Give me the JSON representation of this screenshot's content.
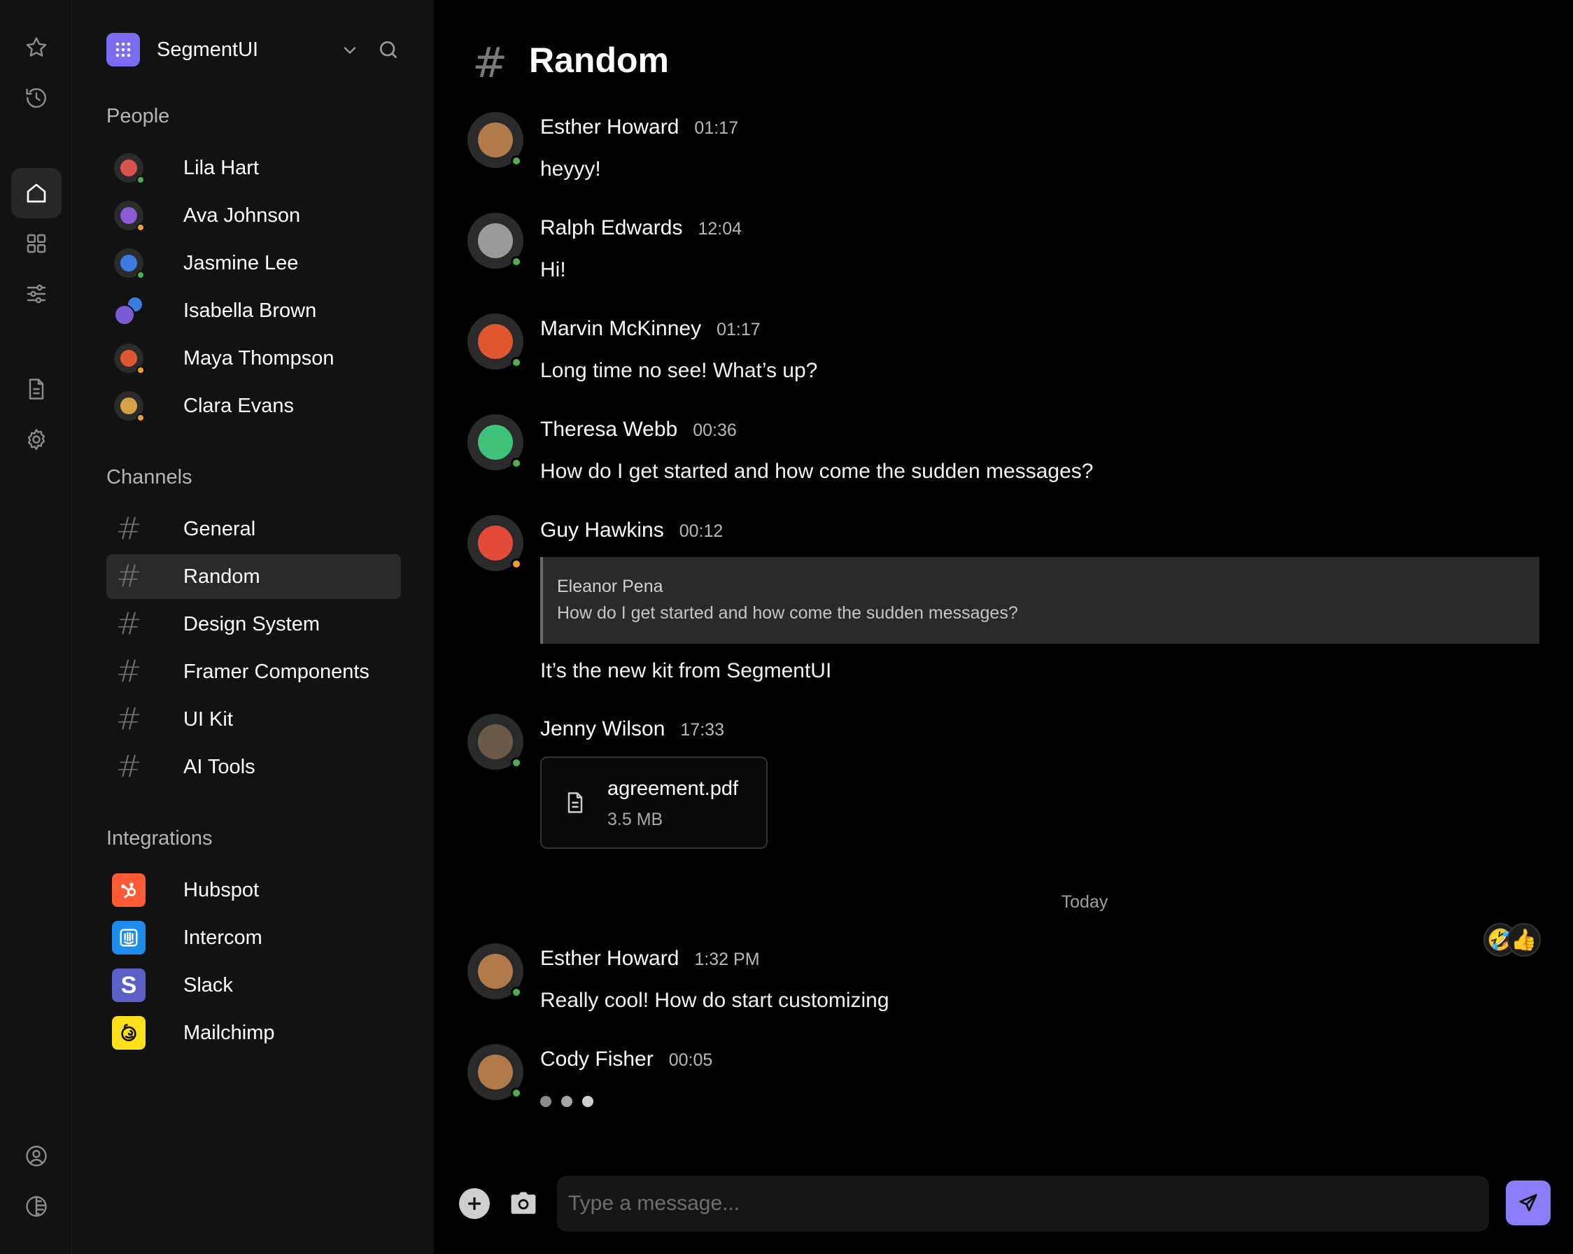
{
  "rail": {
    "items": [
      {
        "icon": "star-icon"
      },
      {
        "icon": "history-icon"
      },
      {
        "icon": "home-icon",
        "active": true
      },
      {
        "icon": "grid-icon"
      },
      {
        "icon": "sliders-icon"
      },
      {
        "icon": "document-icon"
      },
      {
        "icon": "settings-icon"
      },
      {
        "icon": "user-circle-icon"
      },
      {
        "icon": "theme-icon"
      }
    ]
  },
  "workspace": {
    "name": "SegmentUI"
  },
  "people": {
    "title": "People",
    "items": [
      {
        "name": "Lila Hart",
        "status": "online",
        "status_color": "#4caf50",
        "avatar_color": "#d9534f"
      },
      {
        "name": "Ava Johnson",
        "status": "away",
        "status_color": "#f0a030",
        "avatar_color": "#8e5bd6"
      },
      {
        "name": "Jasmine Lee",
        "status": "online",
        "status_color": "#4caf50",
        "avatar_color": "#3d7be0"
      },
      {
        "name": "Isabella Brown",
        "status": "group",
        "status_color": "#4caf50",
        "avatar_color": "#7a5bd6"
      },
      {
        "name": "Maya Thompson",
        "status": "away",
        "status_color": "#f0a030",
        "avatar_color": "#e0562f"
      },
      {
        "name": "Clara Evans",
        "status": "away",
        "status_color": "#f0a030",
        "avatar_color": "#d7a24a"
      }
    ]
  },
  "channels": {
    "title": "Channels",
    "items": [
      {
        "name": "General"
      },
      {
        "name": "Random",
        "active": true
      },
      {
        "name": "Design System"
      },
      {
        "name": "Framer Components"
      },
      {
        "name": "UI Kit"
      },
      {
        "name": "AI Tools"
      }
    ]
  },
  "integrations": {
    "title": "Integrations",
    "items": [
      {
        "name": "Hubspot",
        "icon": "hubspot-icon",
        "color": "#ff5c35"
      },
      {
        "name": "Intercom",
        "icon": "intercom-icon",
        "color": "#1f8ded"
      },
      {
        "name": "Slack",
        "icon": "slack-icon",
        "color": "#5b5fc7"
      },
      {
        "name": "Mailchimp",
        "icon": "mailchimp-icon",
        "color": "#ffe01b"
      }
    ]
  },
  "channel_header": {
    "hash": "#",
    "title": "Random"
  },
  "messages": [
    {
      "author": "Esther Howard",
      "time": "01:17",
      "text": "heyyy!",
      "status_color": "#4caf50",
      "avatar_color": "#b07a4a"
    },
    {
      "author": "Ralph Edwards",
      "time": "12:04",
      "text": "Hi!",
      "status_color": "#4caf50",
      "avatar_color": "#9a9a9a"
    },
    {
      "author": "Marvin McKinney",
      "time": "01:17",
      "text": "Long time no see! What’s up?",
      "status_color": "#4caf50",
      "avatar_color": "#e0562f"
    },
    {
      "author": "Theresa Webb",
      "time": "00:36",
      "text": "How do I get started and how come the sudden messages?",
      "status_color": "#4caf50",
      "avatar_color": "#3fc27a"
    },
    {
      "author": "Guy Hawkins",
      "time": "00:12",
      "text": "It’s the new kit from SegmentUI",
      "status_color": "#f0a030",
      "avatar_color": "#e34a3a",
      "quote": {
        "author": "Eleanor Pena",
        "text": "How do I get started and how come the sudden messages?"
      }
    },
    {
      "author": "Jenny Wilson",
      "time": "17:33",
      "status_color": "#4caf50",
      "avatar_color": "#6b5a4a",
      "file": {
        "name": "agreement.pdf",
        "size": "3.5 MB",
        "icon": "document-icon"
      }
    },
    {
      "author": "Esther Howard",
      "time": "1:32 PM",
      "text": "Really cool! How do start customizing",
      "status_color": "#4caf50",
      "avatar_color": "#b07a4a",
      "reactions": [
        "🤣",
        "👍"
      ]
    },
    {
      "author": "Cody Fisher",
      "time": "00:05",
      "typing": true,
      "status_color": "#4caf50",
      "avatar_color": "#b07a4a"
    }
  ],
  "divider": {
    "label": "Today"
  },
  "composer": {
    "placeholder": "Type a message..."
  },
  "colors": {
    "accent": "#8b7df7",
    "online": "#4caf50",
    "away": "#f0a030"
  }
}
